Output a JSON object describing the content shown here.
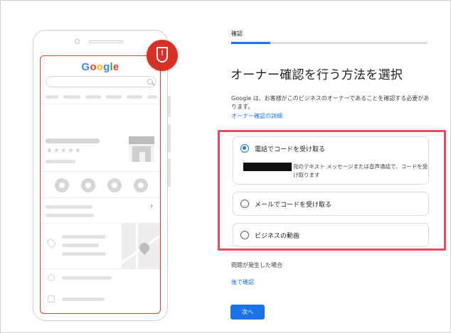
{
  "phone_illustration": {
    "logo_letters": [
      {
        "char": "G",
        "color": "#4285f4"
      },
      {
        "char": "o",
        "color": "#ea4335"
      },
      {
        "char": "o",
        "color": "#fbbc05"
      },
      {
        "char": "g",
        "color": "#4285f4"
      },
      {
        "char": "l",
        "color": "#34a853"
      },
      {
        "char": "e",
        "color": "#ea4335"
      }
    ],
    "stars": "★★★★★",
    "chevron": "›",
    "badge_icon": "shield-alert-icon",
    "badge_glyph": "!",
    "badge_color": "#d93025",
    "screen_outline_color": "#e53935"
  },
  "verification": {
    "tab_label": "確認",
    "title": "オーナー確認を行う方法を選択",
    "description": "Google は、お客様がこのビジネスのオーナーであることを確認する必要があります。",
    "learn_more_link": "オーナー確認の詳細",
    "options": [
      {
        "label": "電話でコードを受け取る",
        "selected": true,
        "detail": "宛のテキスト メッセージまたは音声通話で、コードを受け取ります"
      },
      {
        "label": "メールでコードを受け取る",
        "selected": false
      },
      {
        "label": "ビジネスの動画",
        "selected": false
      }
    ],
    "trouble_text": "問題が発生した場合",
    "later_link": "後で確認",
    "next_button": "次へ"
  },
  "colors": {
    "accent": "#1a73e8",
    "highlight_border": "#e74c5e"
  }
}
